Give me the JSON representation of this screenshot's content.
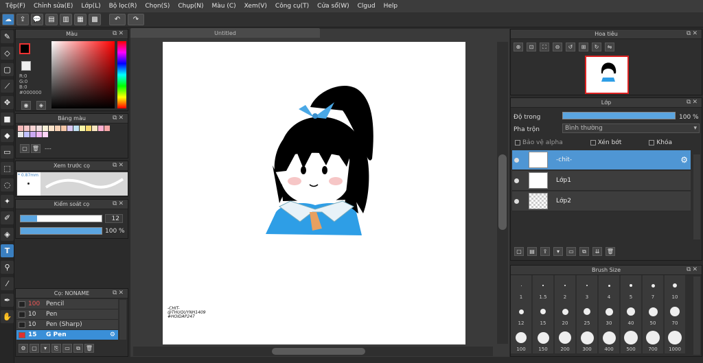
{
  "menu": [
    "Tệp(F)",
    "Chỉnh sửa(E)",
    "Lớp(L)",
    "Bộ lọc(R)",
    "Chọn(S)",
    "Chụp(N)",
    "Màu (C)",
    "Xem(V)",
    "Công cụ(T)",
    "Cửa sổ(W)",
    "Clgud",
    "Help"
  ],
  "color_panel": {
    "title": "Màu",
    "r": "R:0",
    "g": "G:0",
    "b": "B:0",
    "hex": "#000000"
  },
  "palette_panel": {
    "title": "Bảng màu",
    "name": "---",
    "colors": [
      "#f4b8b8",
      "#f6c7c7",
      "#f8d5d5",
      "#f0e0e0",
      "#f8f0d8",
      "#fbe3c9",
      "#f6d1b5",
      "#f5c6a7",
      "#d9c6f0",
      "#bfe0f0",
      "#f9f6a8",
      "#f7d96f",
      "#f8e7c1",
      "#ffb0d0",
      "#f6a6a6",
      "#e6e6e6",
      "#c1c1ff",
      "#cba8f2",
      "#f2b8f2",
      "#ffd6f8"
    ]
  },
  "preview_panel": {
    "title": "Xem trước cọ",
    "size": "* 0.87mm"
  },
  "control_panel": {
    "title": "Kiểm soát cọ",
    "size": "12",
    "opacity": "100 %",
    "size_fill": 0.2,
    "opacity_fill": 1.0
  },
  "brush_panel": {
    "title": "Cọ: NONAME",
    "brushes": [
      {
        "size": "100",
        "name": "Pencil",
        "color": "#222"
      },
      {
        "size": "10",
        "name": "Pen",
        "color": "#222"
      },
      {
        "size": "10",
        "name": "Pen (Sharp)",
        "color": "#222"
      },
      {
        "size": "15",
        "name": "G Pen",
        "color": "#e03030"
      }
    ]
  },
  "canvas": {
    "tab": "Untitled",
    "signature": [
      "-CHIT-",
      "@THUQUYNH1409",
      "#HOIDAP247"
    ]
  },
  "navigator": {
    "title": "Hoa tiêu"
  },
  "layer_panel": {
    "title": "Lớp",
    "opacity_label": "Độ trong",
    "opacity_value": "100 %",
    "blend_label": "Pha trộn",
    "blend_value": "Bình thường",
    "alpha_protect": "Bảo vệ alpha",
    "clipping": "Xén bớt",
    "lock": "Khóa",
    "layers": [
      {
        "name": "-chit-",
        "selected": true
      },
      {
        "name": "Lớp1",
        "selected": false
      },
      {
        "name": "Lớp2",
        "selected": false
      }
    ]
  },
  "brush_size": {
    "title": "Brush Size",
    "sizes": [
      "1",
      "1.5",
      "2",
      "3",
      "4",
      "5",
      "7",
      "10",
      "12",
      "15",
      "20",
      "25",
      "30",
      "40",
      "50",
      "70",
      "100",
      "150",
      "200",
      "300",
      "400",
      "500",
      "700",
      "1000"
    ]
  }
}
